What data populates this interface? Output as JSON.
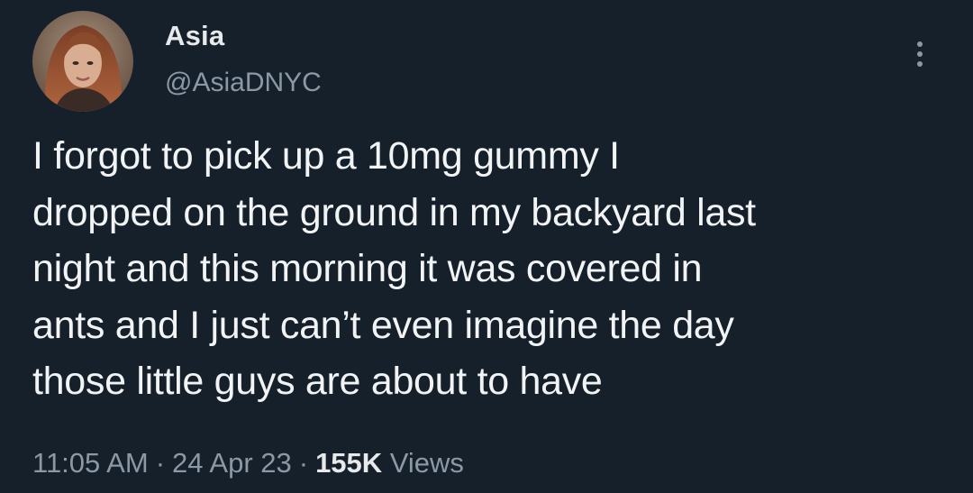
{
  "author": {
    "display_name": "Asia",
    "handle": "@AsiaDNYC"
  },
  "tweet": {
    "lines": [
      "I forgot to pick up a 10mg gummy I",
      "dropped on the ground in my backyard last",
      "night and this morning it was covered in",
      "ants and I just can’t even imagine the day",
      "those little guys are about to have"
    ]
  },
  "meta": {
    "time": "11:05 AM",
    "date": "24 Apr 23",
    "separator": "·",
    "views_count": "155K",
    "views_label": "Views"
  },
  "icons": {
    "more": "more-options-icon",
    "avatar": "avatar-photo"
  },
  "colors": {
    "background": "#15202b",
    "primary_text": "#e7e9ea",
    "secondary_text": "#8b98a5"
  }
}
